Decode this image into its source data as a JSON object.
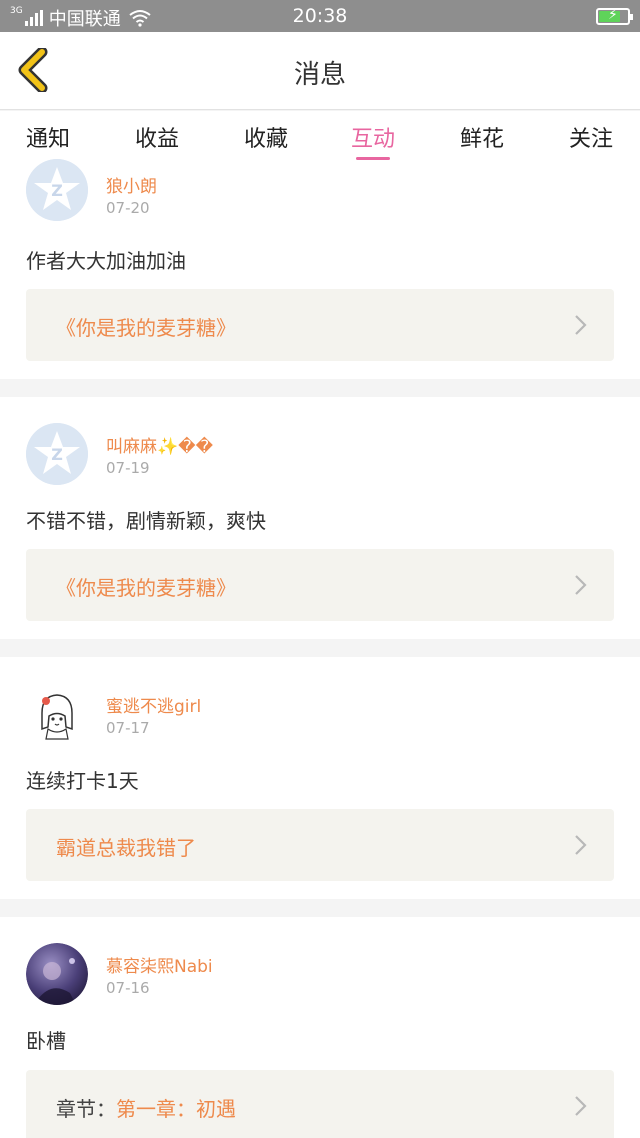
{
  "status_bar": {
    "network_type": "3G",
    "carrier": "中国联通",
    "time": "20:38",
    "battery_level": 0.75,
    "battery_color": "#5fd35a"
  },
  "nav": {
    "title": "消息",
    "back_icon": "chevron-left-icon",
    "back_icon_color": "#f2c318"
  },
  "tabs": [
    {
      "label": "通知"
    },
    {
      "label": "收益"
    },
    {
      "label": "收藏"
    },
    {
      "label": "互动",
      "active": true
    },
    {
      "label": "鲜花"
    },
    {
      "label": "关注"
    }
  ],
  "accent_color": "#e866a0",
  "name_color": "#ee8a4c",
  "messages": [
    {
      "username": "狼小朗",
      "date": "07-20",
      "avatar": "default-avatar-icon",
      "comment": "作者大大加油加油",
      "link_text": "《你是我的麦芽糖》"
    },
    {
      "username": "叫麻麻✨��",
      "date": "07-19",
      "avatar": "default-avatar-icon",
      "comment": "不错不错，剧情新颖，爽快",
      "link_text": "《你是我的麦芽糖》"
    },
    {
      "username": "蜜逃不逃girl",
      "date": "07-17",
      "avatar": "cartoon-girl-avatar",
      "comment": "连续打卡1天",
      "link_text": "霸道总裁我错了"
    },
    {
      "username": "慕容柒熙Nabi",
      "date": "07-16",
      "avatar": "photo-avatar",
      "comment": "卧槽",
      "link_prefix": "章节：",
      "link_text": "第一章：初遇"
    }
  ]
}
